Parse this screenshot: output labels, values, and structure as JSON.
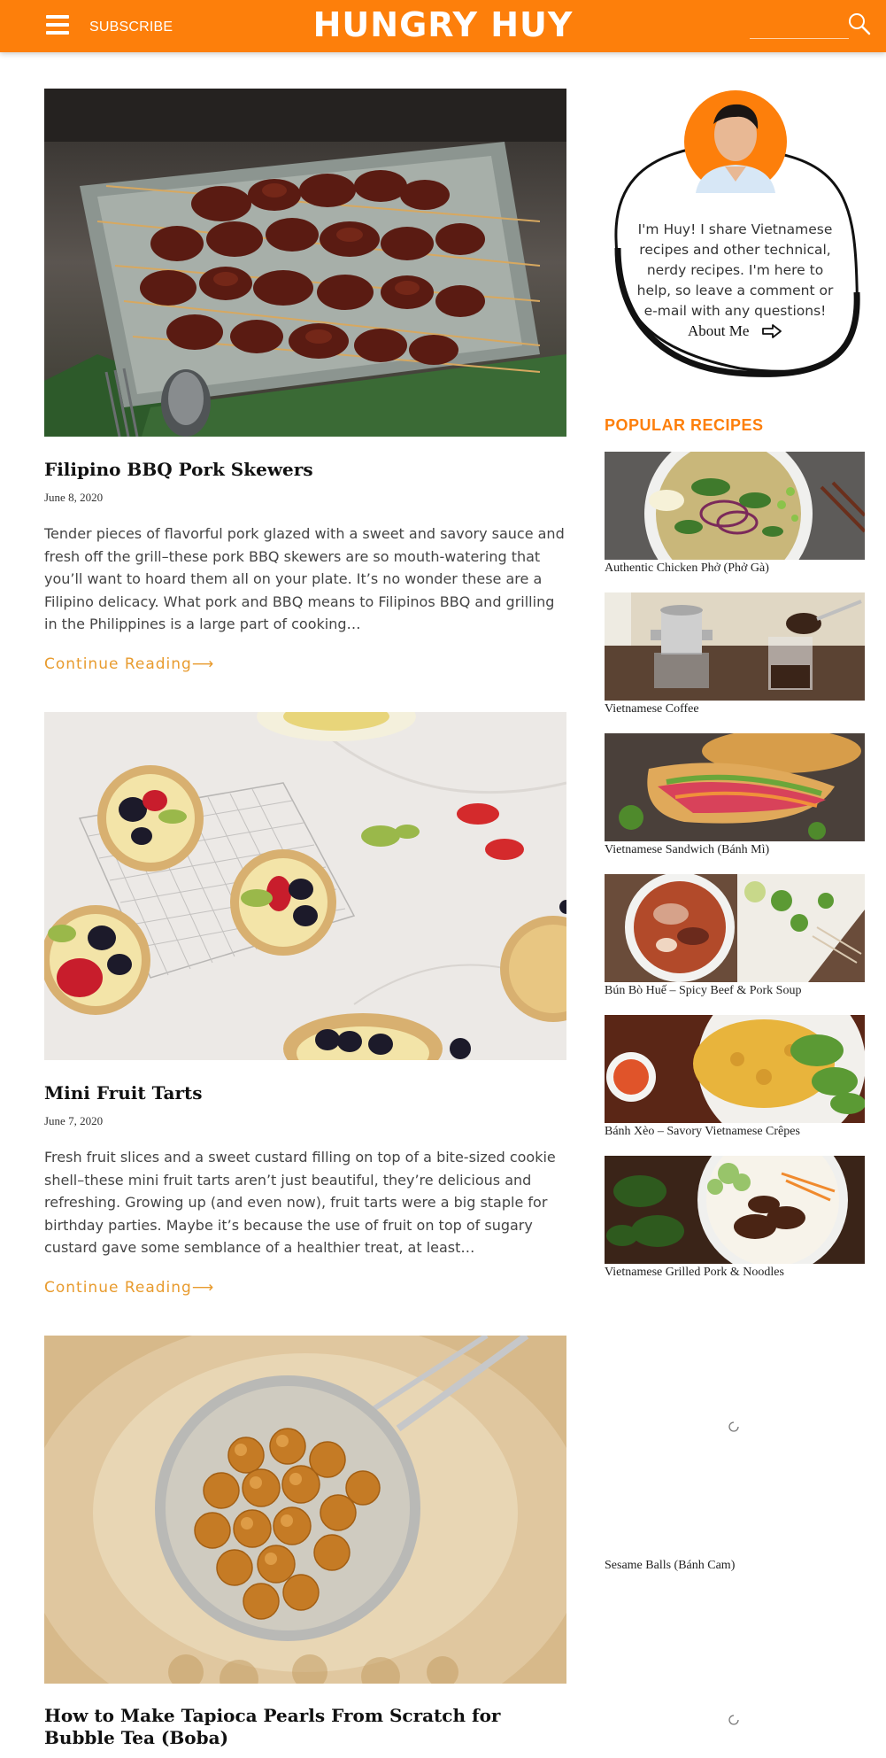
{
  "header": {
    "subscribe_label": "SUBSCRIBE",
    "logo_text": "HUNGRY HUY",
    "search_placeholder": "",
    "bg_color": "#fd7f0b"
  },
  "posts": [
    {
      "title": "Filipino BBQ Pork Skewers",
      "date": "June 8, 2020",
      "excerpt": "Tender pieces of flavorful pork glazed with a sweet and savory sauce and fresh off the grill–these pork BBQ skewers are so mouth-watering that you’ll want to hoard them all on your plate. It’s no wonder these are a Filipino delicacy.  What pork and BBQ means to Filipinos BBQ and grilling in the Philippines is a large part of cooking…",
      "continue_label": "Continue Reading⟶"
    },
    {
      "title": "Mini Fruit Tarts",
      "date": "June 7, 2020",
      "excerpt": "Fresh fruit slices and a sweet custard filling on top of a bite-sized cookie shell–these mini fruit tarts aren’t just beautiful, they’re delicious and refreshing. Growing up (and even now), fruit tarts were a big staple for birthday parties. Maybe it’s because the use of fruit on top of sugary custard gave some semblance of a healthier treat, at least…",
      "continue_label": "Continue Reading⟶"
    },
    {
      "title": "How to Make Tapioca Pearls From Scratch for Bubble Tea (Boba)"
    }
  ],
  "sidebar": {
    "bio_text": "I'm Huy! I share Vietnamese recipes and other technical, nerdy recipes. I'm here to help, so leave a comment or e-mail with any questions!",
    "about_label": "About Me",
    "popular_heading": "POPULAR RECIPES",
    "popular": [
      "Authentic Chicken Phở (Phở Gà)",
      "Vietnamese Coffee",
      "Vietnamese Sandwich (Bánh Mì)",
      "Bún Bò Huế – Spicy Beef & Pork Soup",
      "Bánh Xèo – Savory Vietnamese Crêpes",
      "Vietnamese Grilled Pork & Noodles",
      "Sesame Balls (Bánh Cam)"
    ]
  },
  "colors": {
    "accent": "#fd7f0b",
    "continue": "#e89b2e"
  }
}
